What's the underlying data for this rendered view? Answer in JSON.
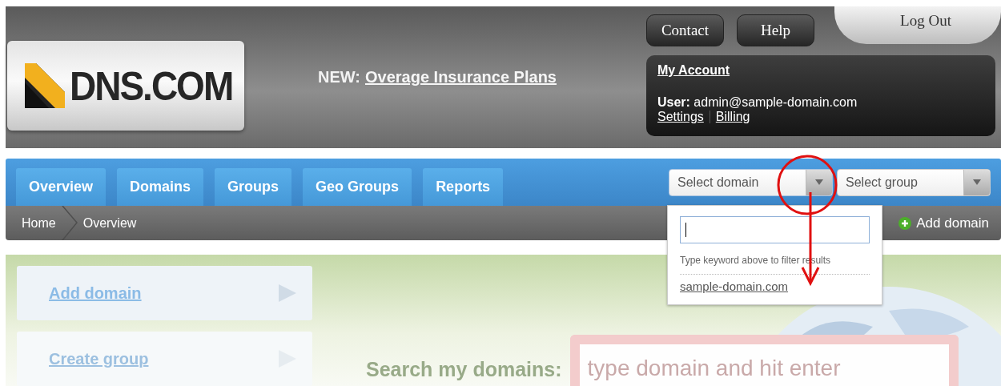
{
  "logo": {
    "text": "DNS.COM"
  },
  "announcement": {
    "prefix": "NEW:",
    "link": "Overage Insurance Plans"
  },
  "top_buttons": [
    "Contact",
    "Help"
  ],
  "logout": "Log Out",
  "account": {
    "title": "My Account",
    "user_label": "User:",
    "user": "admin@sample-domain.com",
    "links": [
      "Settings",
      "Billing"
    ]
  },
  "tabs": [
    {
      "label": "Overview"
    },
    {
      "label": "Domains"
    },
    {
      "label": "Groups"
    },
    {
      "label": "Geo Groups"
    },
    {
      "label": "Reports"
    }
  ],
  "selects": [
    {
      "label": "Select domain",
      "open": true
    },
    {
      "label": "Select group",
      "open": false
    }
  ],
  "breadcrumb": [
    "Home",
    "Overview"
  ],
  "add_domain_action": "Add domain",
  "domain_dropdown": {
    "hint": "Type keyword above to filter results",
    "options": [
      "sample-domain.com"
    ]
  },
  "quick_links": [
    "Add domain",
    "Create group"
  ],
  "search": {
    "label": "Search my domains:",
    "placeholder": "type domain and hit enter"
  }
}
